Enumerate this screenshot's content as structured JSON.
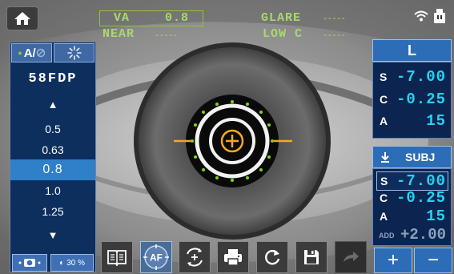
{
  "status": {
    "va_label": "VA",
    "va_value": "0.8",
    "near_label": "NEAR",
    "near_value": "-----",
    "glare_label": "GLARE",
    "glare_value": "-----",
    "lowc_label": "LOW C",
    "lowc_value": "-----"
  },
  "left_panel": {
    "mode_label": "A/",
    "program": "58FDP",
    "va_options": [
      "0.5",
      "0.63",
      "0.8",
      "1.0",
      "1.25"
    ],
    "selected": "0.8",
    "contrast": "30 %"
  },
  "right_panel": {
    "eye_label": "L",
    "top": [
      {
        "label": "S",
        "value": "-7.00"
      },
      {
        "label": "C",
        "value": "-0.25"
      },
      {
        "label": "A",
        "value": "15"
      }
    ],
    "mode_label": "SUBJ",
    "bottom": [
      {
        "label": "S",
        "value": "-7.00"
      },
      {
        "label": "C",
        "value": "-0.25"
      },
      {
        "label": "A",
        "value": "15"
      }
    ],
    "add_label": "ADD",
    "add_value": "+2.00",
    "plus": "+",
    "minus": "−"
  },
  "toolbar": {
    "af_label": "AF"
  }
}
